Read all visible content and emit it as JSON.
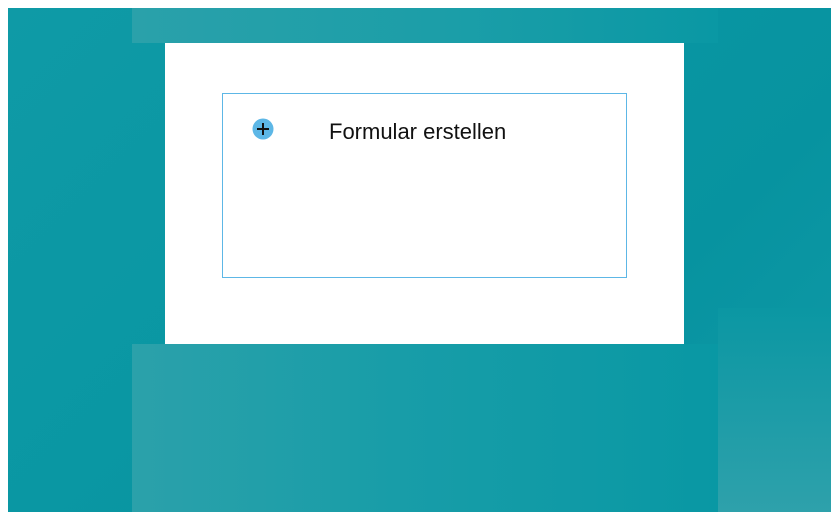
{
  "create_form": {
    "label": "Formular erstellen",
    "icon": "plus-circle-icon",
    "accent_color": "#5db7e6"
  },
  "colors": {
    "background": "#0a97a3",
    "card": "#ffffff"
  }
}
